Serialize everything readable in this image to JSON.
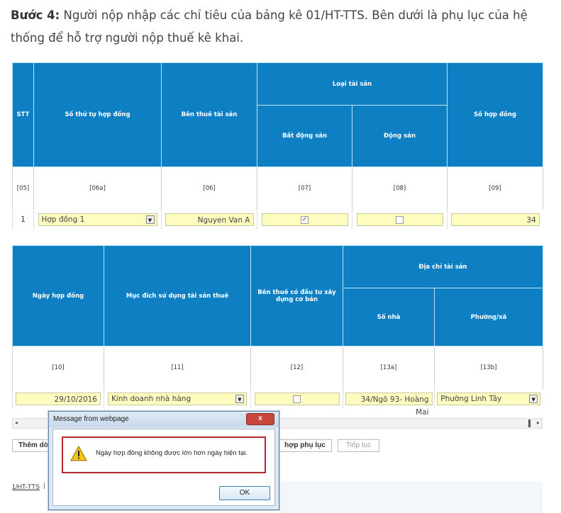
{
  "intro": {
    "step": "Bước 4:",
    "text": "Người nộp nhập các chỉ tiêu của bảng kê 01/HT-TTS. Bên dưới là phụ lục của hệ thống để hỗ trợ người nộp thuế kê khai."
  },
  "table1": {
    "headers": {
      "stt": "STT",
      "so_thu_tu": "Số thứ tự hợp đồng",
      "ben_thue": "Bên thuê tài sản",
      "loai_tai_san": "Loại tài sản",
      "bat_dong_san": "Bất động sản",
      "dong_san": "Động sản",
      "so_hop_dong": "Số hợp đồng"
    },
    "index": [
      "[05]",
      "[06a]",
      "[06]",
      "[07]",
      "[08]",
      "[09]"
    ],
    "row": {
      "stt": "1",
      "contract": "Hợp đồng 1",
      "lessee": "Nguyen Van A",
      "bds_checked": "✓",
      "ds_checked": "",
      "so_hop_dong": "34"
    }
  },
  "table2": {
    "headers": {
      "ngay": "Ngày hợp đồng",
      "muc_dich": "Mục đích sử dụng tài sản thuê",
      "ben_thue_dau_tu": "Bên thuê có đầu tư xây dựng cơ bản",
      "dia_chi": "Địa chỉ tài sản",
      "so_nha": "Số nhà",
      "phuong": "Phường/xã"
    },
    "index": [
      "[10]",
      "[11]",
      "[12]",
      "[13a]",
      "[13b]"
    ],
    "row": {
      "date": "29/10/2016",
      "purpose": "Kinh doanh nhà hàng",
      "investment": "",
      "house_no": "34/Ngõ 93- Hoàng Mai",
      "ward": "Phường Linh Tây"
    }
  },
  "buttons": {
    "add": "Thêm dò",
    "appendix": "hợp phụ lục",
    "next": "Tiếp tục"
  },
  "footer_link": "1/HT-TTS",
  "dialog": {
    "title": "Message from webpage",
    "message": "Ngày hợp đồng không được lớn hơn ngày hiện tại.",
    "ok": "OK",
    "close": "x"
  }
}
